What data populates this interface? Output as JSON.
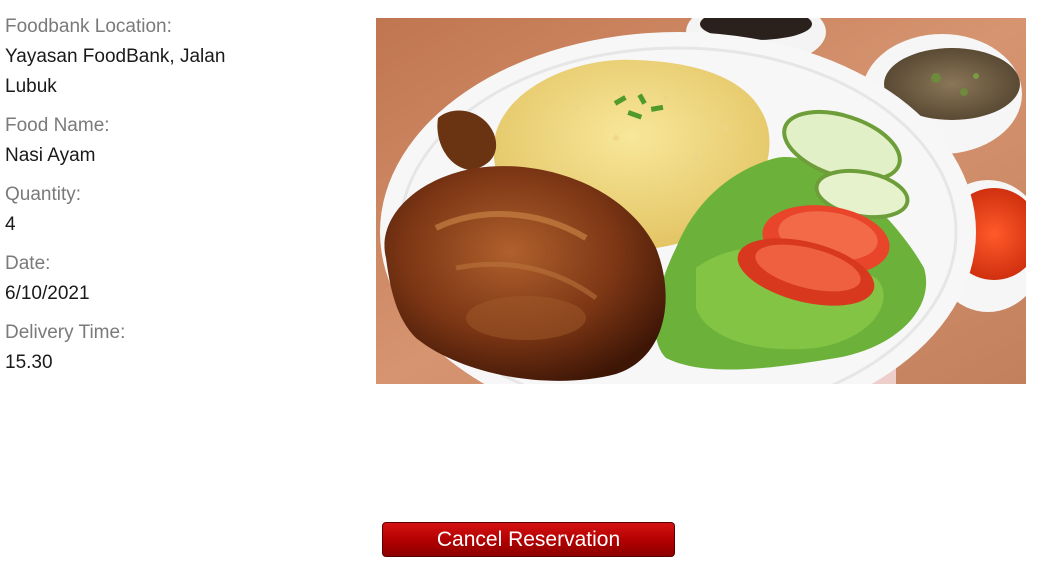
{
  "reservation": {
    "fields": [
      {
        "label": "Foodbank Location:",
        "value": "Yayasan FoodBank, Jalan Lubuk"
      },
      {
        "label": "Food Name:",
        "value": "Nasi Ayam"
      },
      {
        "label": "Quantity:",
        "value": "4"
      },
      {
        "label": "Date:",
        "value": "6/10/2021"
      },
      {
        "label": "Delivery Time:",
        "value": "15.30"
      }
    ]
  },
  "actions": {
    "cancel_label": "Cancel Reservation",
    "cancel_color": "#b00000"
  }
}
